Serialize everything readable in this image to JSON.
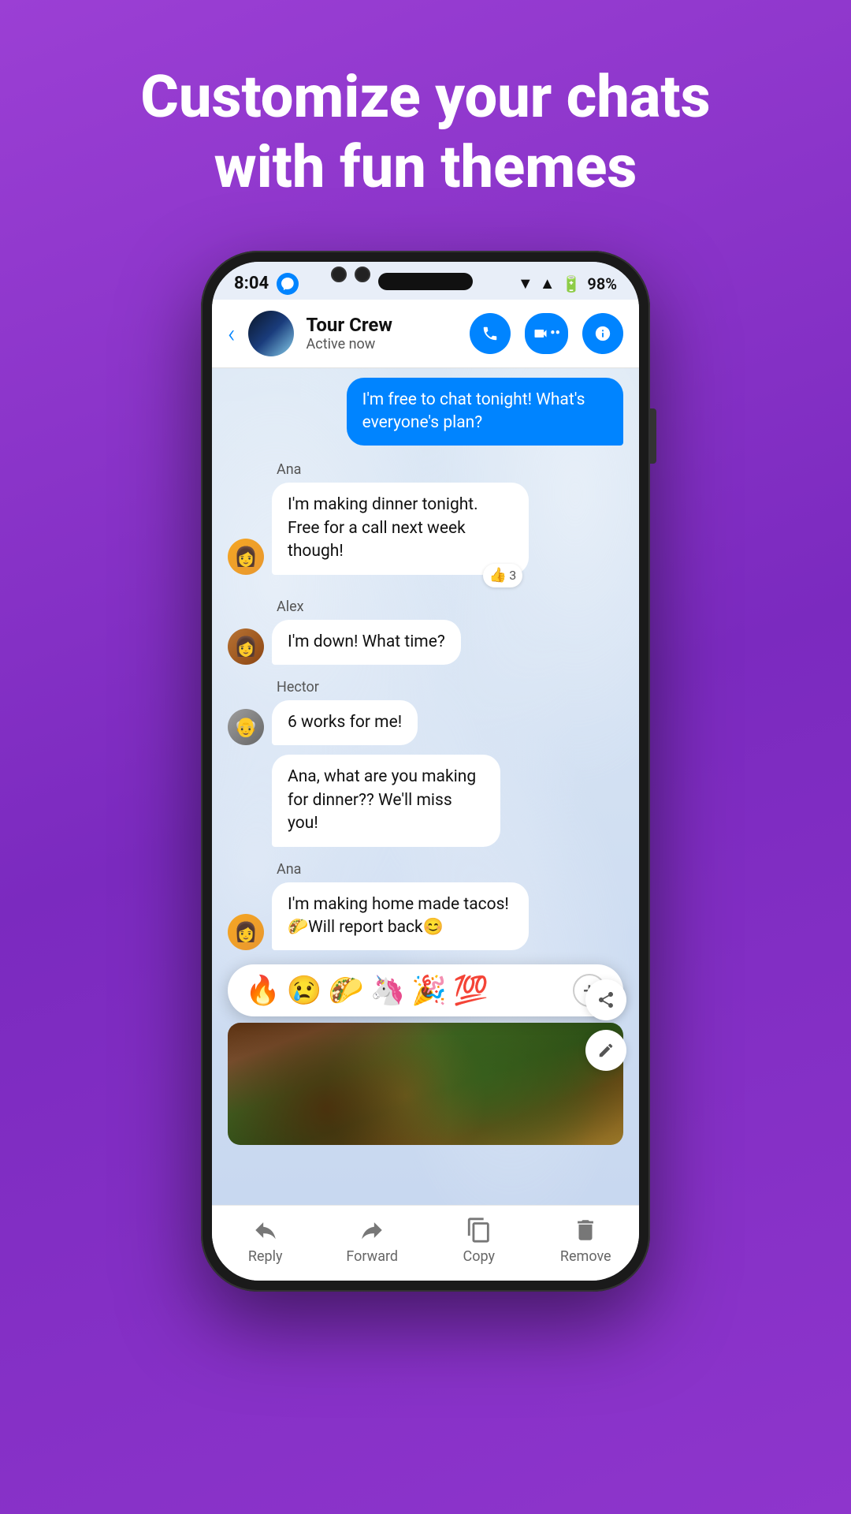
{
  "hero": {
    "line1": "Customize your chats",
    "line2": "with fun themes"
  },
  "status_bar": {
    "time": "8:04",
    "battery": "98%"
  },
  "header": {
    "group_name": "Tour Crew",
    "status": "Active now",
    "back_label": "←"
  },
  "messages": [
    {
      "id": "msg1",
      "type": "outgoing",
      "text": "I'm free to chat tonight! What's everyone's plan?"
    },
    {
      "id": "msg2",
      "sender": "Ana",
      "type": "incoming",
      "text": "I'm making dinner tonight. Free for a call next week though!",
      "reaction": "👍",
      "reaction_count": "3"
    },
    {
      "id": "msg3",
      "sender": "Alex",
      "type": "incoming",
      "text": "I'm down! What time?"
    },
    {
      "id": "msg4",
      "sender": "Hector",
      "type": "incoming",
      "text": "6 works for me!"
    },
    {
      "id": "msg5",
      "sender": "Hector",
      "type": "incoming",
      "text": "Ana, what are you making for dinner?? We'll miss you!"
    },
    {
      "id": "msg6",
      "sender": "Ana",
      "type": "incoming",
      "text": "I'm making home made tacos! 🌮Will report back😊"
    }
  ],
  "emoji_bar": {
    "emojis": [
      "🔥",
      "😢",
      "🌮",
      "🦄",
      "🎉",
      "💯"
    ]
  },
  "side_actions": [
    {
      "id": "share",
      "icon": "share"
    },
    {
      "id": "edit",
      "icon": "edit"
    }
  ],
  "bottom_bar": {
    "actions": [
      {
        "id": "reply",
        "label": "Reply",
        "icon": "↩"
      },
      {
        "id": "forward",
        "label": "Forward",
        "icon": "↪"
      },
      {
        "id": "copy",
        "label": "Copy",
        "icon": "copy"
      },
      {
        "id": "remove",
        "label": "Remove",
        "icon": "🗑"
      }
    ]
  }
}
